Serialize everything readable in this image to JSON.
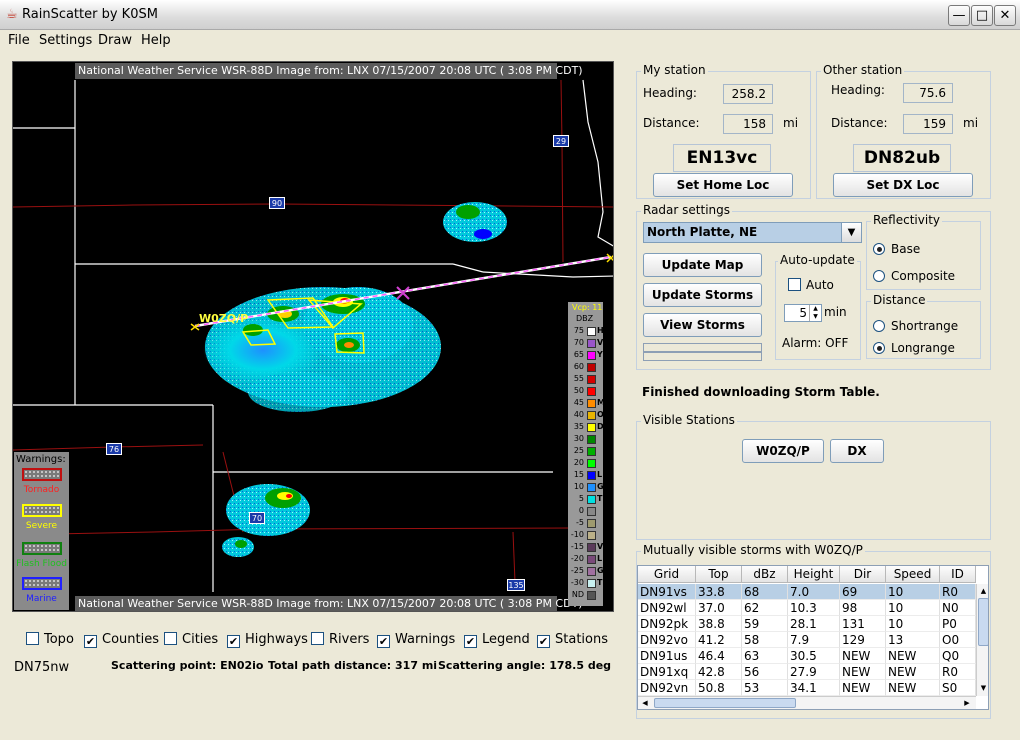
{
  "window": {
    "title": "RainScatter by K0SM",
    "icon": "java-cup-icon"
  },
  "menu": [
    "File",
    "Settings",
    "Draw",
    "Help"
  ],
  "radar": {
    "caption_top": "National Weather Service WSR-88D Image from:  LNX 07/15/2007 20:08 UTC  ( 3:08 PM CDT)",
    "caption_bottom": "National Weather Service WSR-88D Image from:  LNX 07/15/2007 20:08 UTC  ( 3:08 PM CDT)",
    "station_label": "W0ZQ/P",
    "highway_shields": [
      "29",
      "90",
      "76",
      "70",
      "135"
    ],
    "legend_header1": "Vcp: 11",
    "legend_header2": "DBZ",
    "legend": [
      {
        "v": "75",
        "c": "#ffffff",
        "t": "H"
      },
      {
        "v": "70",
        "c": "#9955c9",
        "t": "V"
      },
      {
        "v": "65",
        "c": "#ff00ff",
        "t": "Y"
      },
      {
        "v": "60",
        "c": "#c00000",
        "t": ""
      },
      {
        "v": "55",
        "c": "#d40000",
        "t": ""
      },
      {
        "v": "50",
        "c": "#ff0000",
        "t": ""
      },
      {
        "v": "45",
        "c": "#ff8c00",
        "t": "M"
      },
      {
        "v": "40",
        "c": "#e8b400",
        "t": "O"
      },
      {
        "v": "35",
        "c": "#ffff00",
        "t": "D"
      },
      {
        "v": "30",
        "c": "#008800",
        "t": ""
      },
      {
        "v": "25",
        "c": "#00b000",
        "t": ""
      },
      {
        "v": "20",
        "c": "#00ff00",
        "t": ""
      },
      {
        "v": "15",
        "c": "#0000ff",
        "t": "L"
      },
      {
        "v": "10",
        "c": "#1e90ff",
        "t": "G"
      },
      {
        "v": "5",
        "c": "#00e0e0",
        "t": "T"
      },
      {
        "v": "0",
        "c": "#888888",
        "t": ""
      },
      {
        "v": "-5",
        "c": "#9e9a6e",
        "t": ""
      },
      {
        "v": "-10",
        "c": "#bbb088",
        "t": ""
      },
      {
        "v": "-15",
        "c": "#5a3a5a",
        "t": "V"
      },
      {
        "v": "-20",
        "c": "#7a4a7a",
        "t": "L"
      },
      {
        "v": "-25",
        "c": "#a070a0",
        "t": "G"
      },
      {
        "v": "-30",
        "c": "#c8f0f0",
        "t": "T"
      },
      {
        "v": "ND",
        "c": "#555555",
        "t": ""
      }
    ],
    "warnings_title": "Warnings:",
    "warnings": [
      {
        "label": "Tornado",
        "color": "#ff3030"
      },
      {
        "label": "Severe",
        "color": "#ffff00"
      },
      {
        "label": "Flash Flood",
        "color": "#20a020"
      },
      {
        "label": "Marine",
        "color": "#2020ff"
      }
    ]
  },
  "layers": [
    {
      "label": "Topo",
      "checked": false
    },
    {
      "label": "Counties",
      "checked": true
    },
    {
      "label": "Cities",
      "checked": false
    },
    {
      "label": "Highways",
      "checked": true
    },
    {
      "label": "Rivers",
      "checked": false
    },
    {
      "label": "Warnings",
      "checked": true
    },
    {
      "label": "Legend",
      "checked": true
    },
    {
      "label": "Stations",
      "checked": true
    }
  ],
  "status": {
    "cursor_grid": "DN75nw",
    "scatter_label": "Scattering point:",
    "scatter_value": "EN02io",
    "path_label": "Total path distance:",
    "path_value": "317",
    "path_unit": "mi",
    "angle_label": "Scattering angle:",
    "angle_value": "178.5",
    "angle_unit": "deg"
  },
  "my_station": {
    "title": "My station",
    "heading_label": "Heading:",
    "heading": "258.2",
    "distance_label": "Distance:",
    "distance": "158",
    "unit": "mi",
    "grid": "EN13vc",
    "button": "Set Home Loc"
  },
  "other_station": {
    "title": "Other station",
    "heading_label": "Heading:",
    "heading": "75.6",
    "distance_label": "Distance:",
    "distance": "159",
    "unit": "mi",
    "grid": "DN82ub",
    "button": "Set DX Loc"
  },
  "radar_settings": {
    "title": "Radar settings",
    "site": "North Platte, NE",
    "update_map": "Update Map",
    "update_storms": "Update Storms",
    "view_storms": "View Storms",
    "auto_title": "Auto-update",
    "auto_label": "Auto",
    "minutes": "5",
    "min_label": "min",
    "alarm": "Alarm: OFF",
    "reflectivity_title": "Reflectivity",
    "base": "Base",
    "composite": "Composite",
    "distance_title": "Distance",
    "shortrange": "Shortrange",
    "longrange": "Longrange"
  },
  "status_message": "Finished downloading Storm Table.",
  "visible_stations": {
    "title": "Visible Stations",
    "buttons": [
      "W0ZQ/P",
      "DX"
    ]
  },
  "storms": {
    "title": "Mutually visible storms with W0ZQ/P",
    "columns": [
      "Grid",
      "Top",
      "dBz",
      "Height",
      "Dir",
      "Speed",
      "ID"
    ],
    "rows": [
      [
        "DN91vs",
        "33.8",
        "68",
        "7.0",
        "69",
        "10",
        "R0"
      ],
      [
        "DN92wl",
        "37.0",
        "62",
        "10.3",
        "98",
        "10",
        "N0"
      ],
      [
        "DN92pk",
        "38.8",
        "59",
        "28.1",
        "131",
        "10",
        "P0"
      ],
      [
        "DN92vo",
        "41.2",
        "58",
        "7.9",
        "129",
        "13",
        "O0"
      ],
      [
        "DN91us",
        "46.4",
        "63",
        "30.5",
        "NEW",
        "NEW",
        "Q0"
      ],
      [
        "DN91xq",
        "42.8",
        "56",
        "27.9",
        "NEW",
        "NEW",
        "R0"
      ],
      [
        "DN92vn",
        "50.8",
        "53",
        "34.1",
        "NEW",
        "NEW",
        "S0"
      ]
    ]
  }
}
